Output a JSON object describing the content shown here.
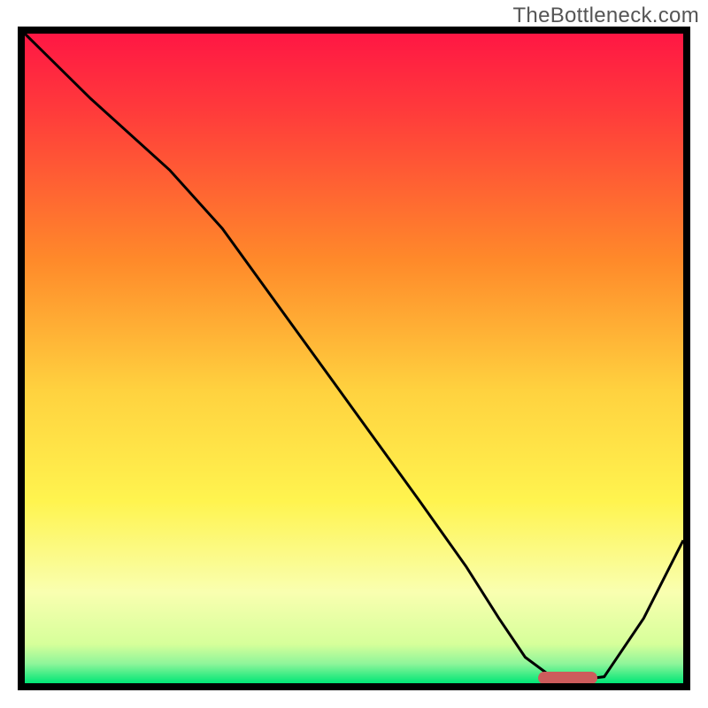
{
  "source_watermark": "TheBottleneck.com",
  "chart_data": {
    "type": "line",
    "title": "",
    "xlabel": "",
    "ylabel": "",
    "xlim": [
      0,
      100
    ],
    "ylim": [
      0,
      100
    ],
    "background": {
      "type": "vertical-gradient",
      "stops": [
        {
          "pct": 0,
          "color": "#ff1744"
        },
        {
          "pct": 12,
          "color": "#ff3b3b"
        },
        {
          "pct": 35,
          "color": "#ff8a2a"
        },
        {
          "pct": 55,
          "color": "#ffd23f"
        },
        {
          "pct": 72,
          "color": "#fff44f"
        },
        {
          "pct": 86,
          "color": "#f9ffb0"
        },
        {
          "pct": 94,
          "color": "#d6ff9a"
        },
        {
          "pct": 97,
          "color": "#8ef59a"
        },
        {
          "pct": 100,
          "color": "#00e676"
        }
      ]
    },
    "series": [
      {
        "name": "bottleneck-curve",
        "color": "#000000",
        "stroke_width": 3,
        "x": [
          0,
          10,
          22,
          30,
          40,
          50,
          60,
          67,
          72,
          76,
          80,
          84,
          88,
          94,
          100
        ],
        "y": [
          100,
          90,
          79,
          70,
          56,
          42,
          28,
          18,
          10,
          4,
          1,
          0.5,
          1,
          10,
          22
        ]
      }
    ],
    "marker": {
      "name": "optimal-range",
      "x_start": 78,
      "x_end": 87,
      "y": 0.8,
      "color": "#cd5c5c"
    }
  }
}
